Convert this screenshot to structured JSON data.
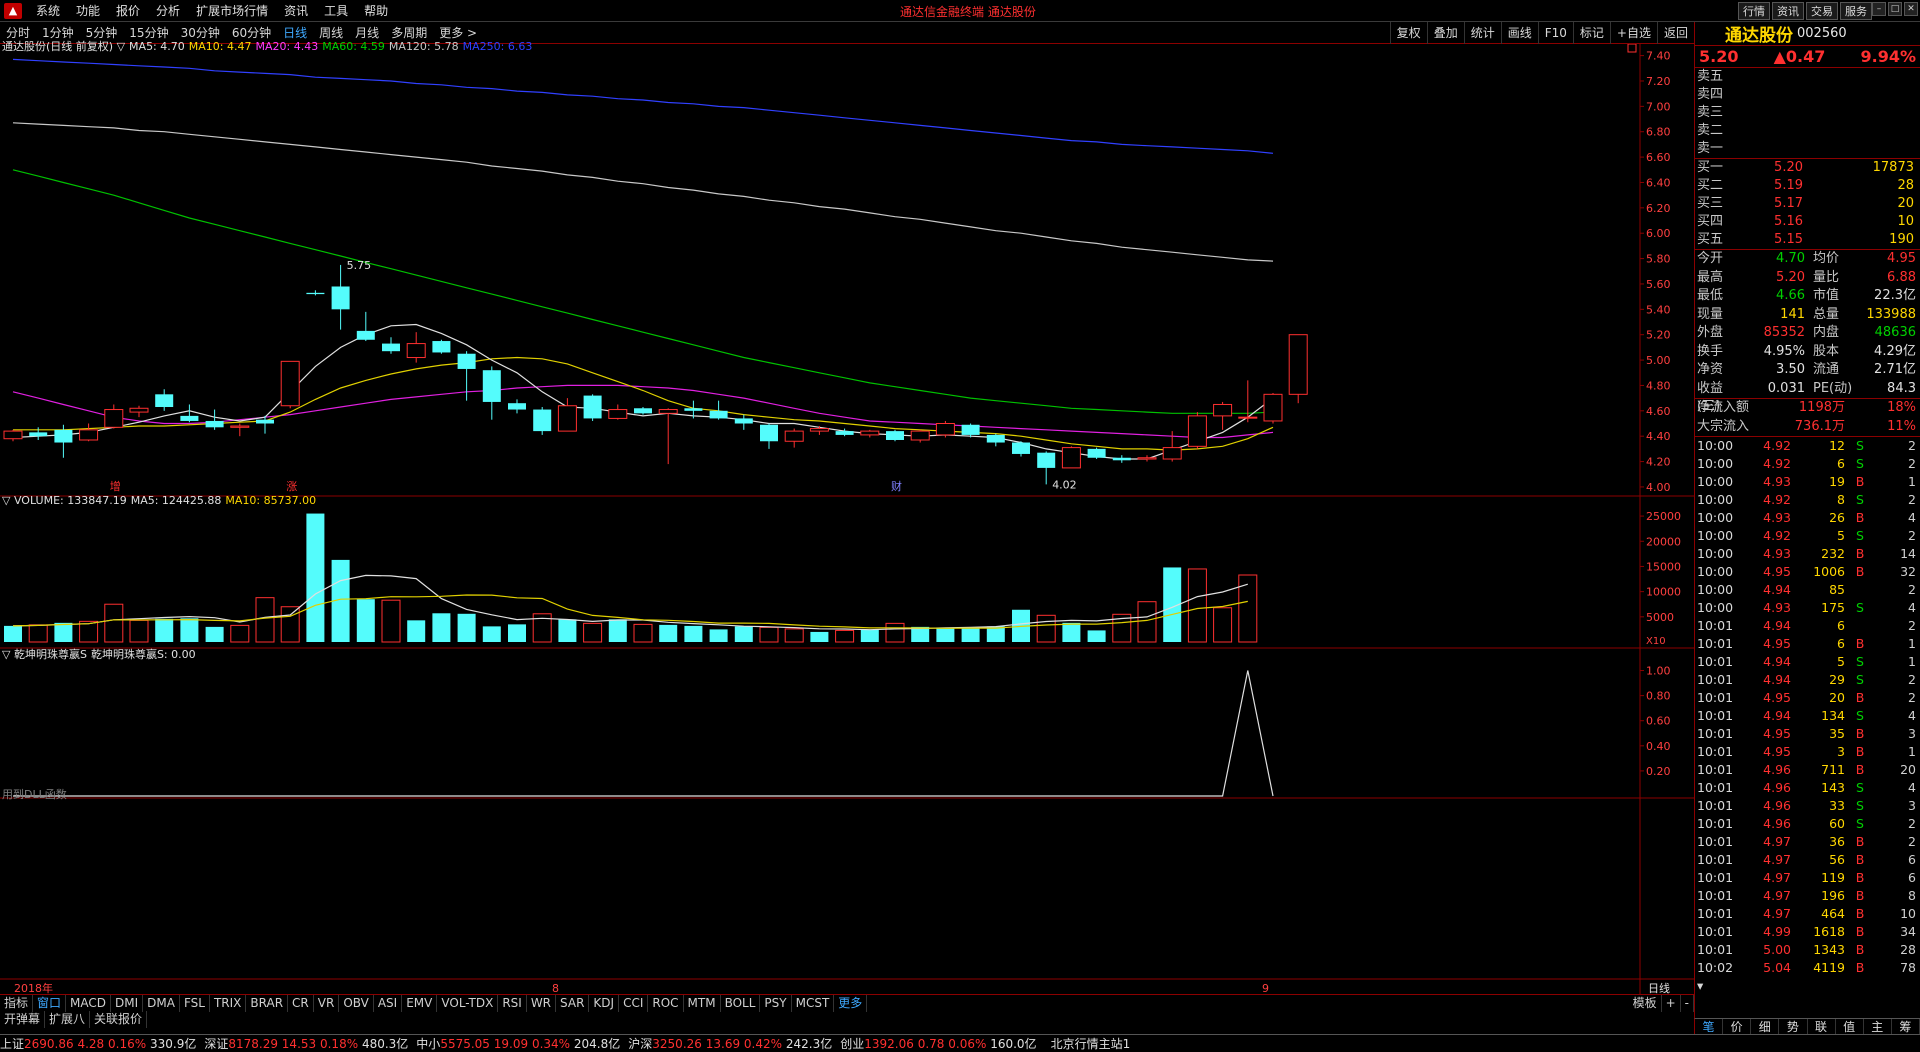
{
  "menu": {
    "items": [
      "系统",
      "功能",
      "报价",
      "分析",
      "扩展市场行情",
      "资讯",
      "工具",
      "帮助"
    ],
    "title": "通达信金融终端 通达股份",
    "right_buttons": [
      "行情",
      "资讯",
      "交易",
      "服务"
    ]
  },
  "periods": [
    "分时",
    "1分钟",
    "5分钟",
    "15分钟",
    "30分钟",
    "60分钟",
    "日线",
    "周线",
    "月线",
    "多周期",
    "更多 >"
  ],
  "active_period": "日线",
  "right_tools": [
    "复权",
    "叠加",
    "统计",
    "画线",
    "F10",
    "标记",
    "+自选",
    "返回"
  ],
  "main_legend": {
    "name": "通达股份(日线 前复权) ▽",
    "ma": [
      {
        "label": "MA5: 4.70",
        "color": "#e0e0e0"
      },
      {
        "label": "MA10: 4.47",
        "color": "#ffd700"
      },
      {
        "label": "MA20: 4.43",
        "color": "#ff3cff"
      },
      {
        "label": "MA60: 4.59",
        "color": "#00d000"
      },
      {
        "label": "MA120: 5.78",
        "color": "#c8c8c8"
      },
      {
        "label": "MA250: 6.63",
        "color": "#3040ff"
      }
    ]
  },
  "price_axis": [
    "7.40",
    "7.20",
    "7.00",
    "6.80",
    "6.60",
    "6.40",
    "6.20",
    "6.00",
    "5.80",
    "5.60",
    "5.40",
    "5.20",
    "5.00",
    "4.80",
    "4.60",
    "4.40",
    "4.20",
    "4.00"
  ],
  "high_label": "5.75",
  "low_label": "4.02",
  "event_marks": [
    "增",
    "涨",
    "财"
  ],
  "volume_legend": {
    "label": "▽ VOLUME: 133847.19",
    "ma5": "MA5: 124425.88",
    "ma10": "MA10: 85737.00"
  },
  "volume_axis": [
    "25000",
    "20000",
    "15000",
    "10000",
    "5000"
  ],
  "volume_unit": "X10",
  "ind_legend": {
    "label": "▽ 乾坤明珠尊嬴S",
    "value": "乾坤明珠尊嬴S: 0.00"
  },
  "ind_axis": [
    "1.00",
    "0.80",
    "0.60",
    "0.40",
    "0.20"
  ],
  "ind_note": "用到DLL函数",
  "date_axis": {
    "labels": [
      "2018年",
      "8",
      "9"
    ],
    "right": "日线"
  },
  "chart_data": {
    "type": "candlestick",
    "candles": [
      [
        4.38,
        4.44,
        4.45,
        4.36
      ],
      [
        4.43,
        4.4,
        4.47,
        4.37
      ],
      [
        4.45,
        4.35,
        4.49,
        4.23
      ],
      [
        4.37,
        4.45,
        4.5,
        4.36
      ],
      [
        4.47,
        4.61,
        4.65,
        4.46
      ],
      [
        4.59,
        4.62,
        4.64,
        4.55
      ],
      [
        4.73,
        4.63,
        4.77,
        4.6
      ],
      [
        4.56,
        4.52,
        4.65,
        4.51
      ],
      [
        4.52,
        4.47,
        4.61,
        4.45
      ],
      [
        4.47,
        4.48,
        4.5,
        4.4
      ],
      [
        4.53,
        4.5,
        4.56,
        4.42
      ],
      [
        4.64,
        4.99,
        4.99,
        4.62
      ],
      [
        5.53,
        5.52,
        5.55,
        5.51
      ],
      [
        5.58,
        5.4,
        5.75,
        5.24
      ],
      [
        5.23,
        5.16,
        5.38,
        5.15
      ],
      [
        5.13,
        5.07,
        5.18,
        5.05
      ],
      [
        5.02,
        5.13,
        5.22,
        4.98
      ],
      [
        5.15,
        5.06,
        5.16,
        5.05
      ],
      [
        5.05,
        4.93,
        5.07,
        4.68
      ],
      [
        4.92,
        4.67,
        4.95,
        4.53
      ],
      [
        4.66,
        4.61,
        4.69,
        4.58
      ],
      [
        4.61,
        4.44,
        4.63,
        4.41
      ],
      [
        4.44,
        4.64,
        4.7,
        4.44
      ],
      [
        4.72,
        4.54,
        4.73,
        4.52
      ],
      [
        4.54,
        4.61,
        4.65,
        4.53
      ],
      [
        4.62,
        4.58,
        4.63,
        4.57
      ],
      [
        4.58,
        4.61,
        4.62,
        4.18
      ],
      [
        4.62,
        4.6,
        4.68,
        4.54
      ],
      [
        4.6,
        4.54,
        4.68,
        4.53
      ],
      [
        4.54,
        4.5,
        4.57,
        4.45
      ],
      [
        4.49,
        4.36,
        4.5,
        4.3
      ],
      [
        4.36,
        4.44,
        4.46,
        4.31
      ],
      [
        4.44,
        4.46,
        4.48,
        4.41
      ],
      [
        4.44,
        4.41,
        4.46,
        4.4
      ],
      [
        4.41,
        4.44,
        4.45,
        4.39
      ],
      [
        4.44,
        4.37,
        4.45,
        4.36
      ],
      [
        4.37,
        4.44,
        4.45,
        4.35
      ],
      [
        4.41,
        4.5,
        4.52,
        4.39
      ],
      [
        4.49,
        4.41,
        4.5,
        4.39
      ],
      [
        4.41,
        4.35,
        4.42,
        4.32
      ],
      [
        4.35,
        4.26,
        4.36,
        4.24
      ],
      [
        4.27,
        4.15,
        4.28,
        4.02
      ],
      [
        4.15,
        4.31,
        4.32,
        4.15
      ],
      [
        4.3,
        4.23,
        4.31,
        4.22
      ],
      [
        4.23,
        4.21,
        4.25,
        4.19
      ],
      [
        4.22,
        4.23,
        4.25,
        4.2
      ],
      [
        4.22,
        4.31,
        4.44,
        4.2
      ],
      [
        4.32,
        4.56,
        4.59,
        4.3
      ],
      [
        4.56,
        4.65,
        4.67,
        4.45
      ],
      [
        4.55,
        4.55,
        4.84,
        4.51
      ],
      [
        4.52,
        4.73,
        4.74,
        4.5
      ],
      [
        4.73,
        5.2,
        5.2,
        4.66
      ]
    ],
    "volume": [
      3200,
      3400,
      3800,
      4100,
      7500,
      4300,
      4600,
      4700,
      3000,
      3300,
      8800,
      7000,
      25500,
      16300,
      8500,
      8300,
      4300,
      5700,
      5600,
      3100,
      3500,
      5600,
      4500,
      3700,
      4500,
      3500,
      3400,
      3200,
      2500,
      3100,
      2900,
      2600,
      2000,
      2300,
      2400,
      3700,
      3000,
      2700,
      2800,
      3100,
      6400,
      5300,
      3800,
      2300,
      5500,
      8000,
      14800,
      14500,
      6800,
      13300
    ],
    "vol_up": [
      0,
      1,
      0,
      1,
      1,
      1,
      0,
      0,
      0,
      1,
      1,
      1,
      0,
      0,
      0,
      1,
      0,
      0,
      0,
      0,
      0,
      1,
      0,
      1,
      0,
      1,
      0,
      0,
      0,
      0,
      1,
      1,
      0,
      1,
      0,
      1,
      0,
      0,
      0,
      0,
      0,
      1,
      0,
      0,
      1,
      1,
      0,
      1,
      1,
      1
    ],
    "ma5": [
      4.39,
      4.4,
      4.41,
      4.43,
      4.47,
      4.51,
      4.56,
      4.6,
      4.55,
      4.52,
      4.55,
      4.75,
      4.95,
      5.1,
      5.2,
      5.27,
      5.28,
      5.21,
      5.12,
      5.0,
      4.9,
      4.75,
      4.63,
      4.62,
      4.59,
      4.56,
      4.58,
      4.56,
      4.55,
      4.53,
      4.5,
      4.5,
      4.47,
      4.44,
      4.42,
      4.41,
      4.4,
      4.41,
      4.4,
      4.39,
      4.35,
      4.3,
      4.27,
      4.24,
      4.22,
      4.22,
      4.29,
      4.36,
      4.43,
      4.55,
      4.7
    ],
    "ma10": [
      4.45,
      4.45,
      4.45,
      4.46,
      4.47,
      4.48,
      4.48,
      4.49,
      4.5,
      4.51,
      4.52,
      4.59,
      4.69,
      4.78,
      4.84,
      4.89,
      4.93,
      4.96,
      4.98,
      5.01,
      5.02,
      5.01,
      4.97,
      4.9,
      4.83,
      4.76,
      4.68,
      4.62,
      4.6,
      4.57,
      4.55,
      4.53,
      4.52,
      4.5,
      4.48,
      4.46,
      4.45,
      4.44,
      4.43,
      4.42,
      4.4,
      4.37,
      4.34,
      4.32,
      4.3,
      4.3,
      4.29,
      4.3,
      4.32,
      4.38,
      4.47
    ],
    "ma20": [
      4.75,
      4.7,
      4.65,
      4.6,
      4.55,
      4.52,
      4.5,
      4.5,
      4.51,
      4.53,
      4.55,
      4.57,
      4.6,
      4.63,
      4.66,
      4.69,
      4.71,
      4.73,
      4.75,
      4.76,
      4.78,
      4.79,
      4.8,
      4.8,
      4.8,
      4.79,
      4.78,
      4.76,
      4.73,
      4.7,
      4.66,
      4.62,
      4.58,
      4.55,
      4.52,
      4.51,
      4.5,
      4.49,
      4.48,
      4.47,
      4.46,
      4.45,
      4.44,
      4.43,
      4.42,
      4.41,
      4.4,
      4.39,
      4.39,
      4.41,
      4.43
    ],
    "ma60": [
      6.5,
      6.45,
      6.4,
      6.35,
      6.3,
      6.24,
      6.18,
      6.12,
      6.07,
      6.02,
      5.97,
      5.92,
      5.87,
      5.82,
      5.77,
      5.72,
      5.67,
      5.62,
      5.57,
      5.52,
      5.47,
      5.42,
      5.37,
      5.32,
      5.27,
      5.22,
      5.17,
      5.12,
      5.07,
      5.02,
      4.98,
      4.94,
      4.9,
      4.86,
      4.82,
      4.79,
      4.76,
      4.73,
      4.7,
      4.68,
      4.66,
      4.64,
      4.62,
      4.61,
      4.6,
      4.59,
      4.58,
      4.58,
      4.58,
      4.58,
      4.59
    ],
    "ma120": [
      6.87,
      6.86,
      6.85,
      6.84,
      6.83,
      6.81,
      6.8,
      6.78,
      6.76,
      6.74,
      6.72,
      6.7,
      6.68,
      6.66,
      6.64,
      6.62,
      6.6,
      6.58,
      6.56,
      6.53,
      6.51,
      6.49,
      6.46,
      6.44,
      6.41,
      6.39,
      6.36,
      6.34,
      6.31,
      6.29,
      6.26,
      6.24,
      6.21,
      6.19,
      6.16,
      6.13,
      6.11,
      6.08,
      6.05,
      6.02,
      6.0,
      5.97,
      5.94,
      5.92,
      5.89,
      5.87,
      5.85,
      5.83,
      5.81,
      5.79,
      5.78
    ],
    "ma250": [
      7.37,
      7.36,
      7.35,
      7.34,
      7.33,
      7.32,
      7.31,
      7.3,
      7.28,
      7.27,
      7.26,
      7.25,
      7.23,
      7.22,
      7.21,
      7.2,
      7.18,
      7.17,
      7.15,
      7.14,
      7.12,
      7.11,
      7.09,
      7.08,
      7.06,
      7.05,
      7.03,
      7.02,
      7.0,
      6.99,
      6.97,
      6.95,
      6.93,
      6.91,
      6.89,
      6.87,
      6.85,
      6.83,
      6.81,
      6.79,
      6.77,
      6.75,
      6.73,
      6.72,
      6.7,
      6.69,
      6.68,
      6.67,
      6.66,
      6.65,
      6.63
    ],
    "indicator": [
      0,
      0,
      0,
      0,
      0,
      0,
      0,
      0,
      0,
      0,
      0,
      0,
      0,
      0,
      0,
      0,
      0,
      0,
      0,
      0,
      0,
      0,
      0,
      0,
      0,
      0,
      0,
      0,
      0,
      0,
      0,
      0,
      0,
      0,
      0,
      0,
      0,
      0,
      0,
      0,
      0,
      0,
      0,
      0,
      0,
      0,
      0,
      0,
      0,
      1,
      0
    ],
    "ylim": [
      3.96,
      7.46
    ],
    "vol_ylim": [
      0,
      27000
    ],
    "ind_ylim": [
      0,
      1.1
    ]
  },
  "stock": {
    "name": "通达股份",
    "code": "002560",
    "price": "5.20",
    "change": "▲0.47",
    "pct": "9.94%"
  },
  "orderbook": {
    "sell": [
      {
        "l": "卖五",
        "p": "",
        "v": ""
      },
      {
        "l": "卖四",
        "p": "",
        "v": ""
      },
      {
        "l": "卖三",
        "p": "",
        "v": ""
      },
      {
        "l": "卖二",
        "p": "",
        "v": ""
      },
      {
        "l": "卖一",
        "p": "",
        "v": ""
      }
    ],
    "buy": [
      {
        "l": "买一",
        "p": "5.20",
        "v": "17873"
      },
      {
        "l": "买二",
        "p": "5.19",
        "v": "28"
      },
      {
        "l": "买三",
        "p": "5.17",
        "v": "20"
      },
      {
        "l": "买四",
        "p": "5.16",
        "v": "10"
      },
      {
        "l": "买五",
        "p": "5.15",
        "v": "190"
      }
    ]
  },
  "stats": [
    {
      "a": "今开",
      "b": "4.70",
      "bc": "grn",
      "c": "均价",
      "d": "4.95",
      "dc": "red"
    },
    {
      "a": "最高",
      "b": "5.20",
      "bc": "red",
      "c": "量比",
      "d": "6.88",
      "dc": "red"
    },
    {
      "a": "最低",
      "b": "4.66",
      "bc": "grn",
      "c": "市值",
      "d": "22.3亿",
      "dc": "wht"
    },
    {
      "a": "现量",
      "b": "141",
      "bc": "yel",
      "c": "总量",
      "d": "133988",
      "dc": "yel"
    },
    {
      "a": "外盘",
      "b": "85352",
      "bc": "red",
      "c": "内盘",
      "d": "48636",
      "dc": "grn"
    },
    {
      "a": "换手",
      "b": "4.95%",
      "bc": "wht",
      "c": "股本",
      "d": "4.29亿",
      "dc": "wht"
    },
    {
      "a": "净资",
      "b": "3.50",
      "bc": "wht",
      "c": "流通",
      "d": "2.71亿",
      "dc": "wht"
    },
    {
      "a": "收益(三)",
      "b": "0.031",
      "bc": "wht",
      "c": "PE(动)",
      "d": "84.3",
      "dc": "wht"
    }
  ],
  "flows": [
    {
      "a": "净流入额",
      "b": "1198万",
      "c": "18%"
    },
    {
      "a": "大宗流入",
      "b": "736.1万",
      "c": "11%"
    }
  ],
  "ticks": [
    [
      "10:00",
      "4.92",
      "12",
      "S",
      "2"
    ],
    [
      "10:00",
      "4.92",
      "6",
      "S",
      "2"
    ],
    [
      "10:00",
      "4.93",
      "19",
      "B",
      "1"
    ],
    [
      "10:00",
      "4.92",
      "8",
      "S",
      "2"
    ],
    [
      "10:00",
      "4.93",
      "26",
      "B",
      "4"
    ],
    [
      "10:00",
      "4.92",
      "5",
      "S",
      "2"
    ],
    [
      "10:00",
      "4.93",
      "232",
      "B",
      "14"
    ],
    [
      "10:00",
      "4.95",
      "1006",
      "B",
      "32"
    ],
    [
      "10:00",
      "4.94",
      "85",
      "",
      "2"
    ],
    [
      "10:00",
      "4.93",
      "175",
      "S",
      "4"
    ],
    [
      "10:01",
      "4.94",
      "6",
      "",
      "2"
    ],
    [
      "10:01",
      "4.95",
      "6",
      "B",
      "1"
    ],
    [
      "10:01",
      "4.94",
      "5",
      "S",
      "1"
    ],
    [
      "10:01",
      "4.94",
      "29",
      "S",
      "2"
    ],
    [
      "10:01",
      "4.95",
      "20",
      "B",
      "2"
    ],
    [
      "10:01",
      "4.94",
      "134",
      "S",
      "4"
    ],
    [
      "10:01",
      "4.95",
      "35",
      "B",
      "3"
    ],
    [
      "10:01",
      "4.95",
      "3",
      "B",
      "1"
    ],
    [
      "10:01",
      "4.96",
      "711",
      "B",
      "20"
    ],
    [
      "10:01",
      "4.96",
      "143",
      "S",
      "4"
    ],
    [
      "10:01",
      "4.96",
      "33",
      "S",
      "3"
    ],
    [
      "10:01",
      "4.96",
      "60",
      "S",
      "2"
    ],
    [
      "10:01",
      "4.97",
      "36",
      "B",
      "2"
    ],
    [
      "10:01",
      "4.97",
      "56",
      "B",
      "6"
    ],
    [
      "10:01",
      "4.97",
      "119",
      "B",
      "6"
    ],
    [
      "10:01",
      "4.97",
      "196",
      "B",
      "8"
    ],
    [
      "10:01",
      "4.97",
      "464",
      "B",
      "10"
    ],
    [
      "10:01",
      "4.99",
      "1618",
      "B",
      "34"
    ],
    [
      "10:01",
      "5.00",
      "1343",
      "B",
      "28"
    ],
    [
      "10:02 ▾",
      "5.04",
      "4119",
      "B",
      "78"
    ]
  ],
  "right_tabs": [
    "笔",
    "价",
    "细",
    "势",
    "联",
    "值",
    "主",
    "筹"
  ],
  "indicator_tabs": [
    "指标",
    "窗口",
    "MACD",
    "DMI",
    "DMA",
    "FSL",
    "TRIX",
    "BRAR",
    "CR",
    "VR",
    "OBV",
    "ASI",
    "EMV",
    "VOL-TDX",
    "RSI",
    "WR",
    "SAR",
    "KDJ",
    "CCI",
    "ROC",
    "MTM",
    "BOLL",
    "PSY",
    "MCST",
    "更多"
  ],
  "indicator_right": [
    "模板",
    "+",
    "-"
  ],
  "bottom_tabs": [
    "开弹幕",
    "扩展八",
    "关联报价"
  ],
  "status": [
    {
      "label": "上证",
      "value": "2690.86",
      "chg": "4.28",
      "pct": "0.16%",
      "amt": "330.9亿"
    },
    {
      "label": "深证",
      "value": "8178.29",
      "chg": "14.53",
      "pct": "0.18%",
      "amt": "480.3亿"
    },
    {
      "label": "中小",
      "value": "5575.05",
      "chg": "19.09",
      "pct": "0.34%",
      "amt": "204.8亿"
    },
    {
      "label": "沪深",
      "value": "3250.26",
      "chg": "13.69",
      "pct": "0.42%",
      "amt": "242.3亿"
    },
    {
      "label": "创业",
      "value": "1392.06",
      "chg": "0.78",
      "pct": "0.06%",
      "amt": "160.0亿"
    }
  ],
  "server": "北京行情主站1"
}
